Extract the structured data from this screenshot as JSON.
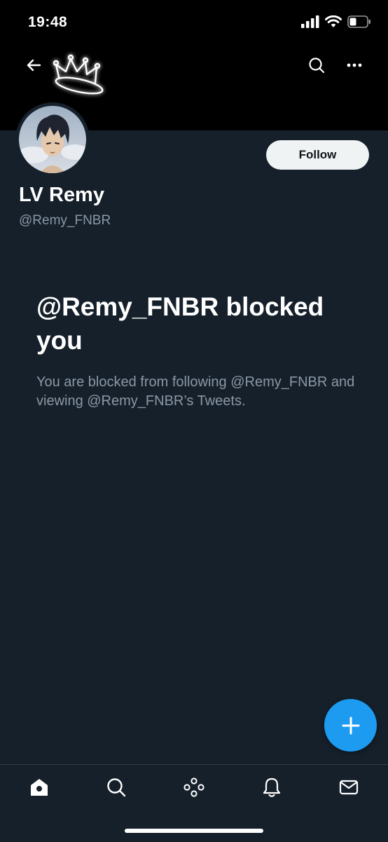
{
  "status_bar": {
    "time": "19:48",
    "icons": [
      "signal-icon",
      "wifi-icon",
      "battery-icon"
    ]
  },
  "header": {
    "back_icon": "back-arrow-icon",
    "search_icon": "search-icon",
    "more_icon": "more-icon",
    "banner_graphic": "neon-crown"
  },
  "profile": {
    "display_name": "LV Remy",
    "handle": "@Remy_FNBR",
    "follow_label": "Follow"
  },
  "blocked": {
    "title": "@Remy_FNBR blocked you",
    "description": "You are blocked from following @Remy_FNBR and viewing @Remy_FNBR’s Tweets."
  },
  "fab": {
    "icon": "plus-icon"
  },
  "tab_bar": {
    "items": [
      {
        "name": "home",
        "icon": "home-icon"
      },
      {
        "name": "search",
        "icon": "search-icon"
      },
      {
        "name": "spaces",
        "icon": "spaces-icon"
      },
      {
        "name": "notifications",
        "icon": "bell-icon"
      },
      {
        "name": "messages",
        "icon": "mail-icon"
      }
    ]
  },
  "colors": {
    "background": "#15202b",
    "banner": "#000000",
    "accent": "#1d9bf0",
    "secondary_text": "#8b98a5",
    "follow_button_bg": "#eff3f4"
  }
}
